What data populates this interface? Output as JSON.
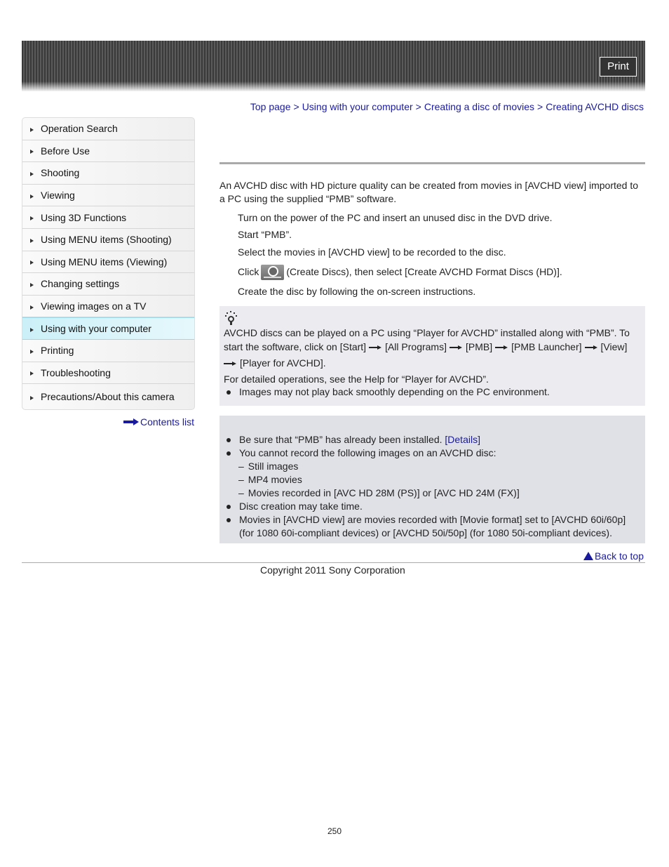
{
  "header": {
    "print_label": "Print"
  },
  "sidebar": {
    "items": [
      {
        "label": "Operation Search"
      },
      {
        "label": "Before Use"
      },
      {
        "label": "Shooting"
      },
      {
        "label": "Viewing"
      },
      {
        "label": "Using 3D Functions"
      },
      {
        "label": "Using MENU items (Shooting)"
      },
      {
        "label": "Using MENU items (Viewing)"
      },
      {
        "label": "Changing settings"
      },
      {
        "label": "Viewing images on a TV"
      },
      {
        "label": "Using with your computer",
        "active": true
      },
      {
        "label": "Printing"
      },
      {
        "label": "Troubleshooting"
      },
      {
        "label": "Precautions/About this camera"
      }
    ],
    "contents_link": "Contents list"
  },
  "breadcrumb": {
    "items": [
      "Top page",
      "Using with your computer",
      "Creating a disc of movies",
      "Creating AVCHD discs"
    ],
    "separator": ">"
  },
  "main": {
    "intro": "An AVCHD disc with HD picture quality can be created from movies in [AVCHD view] imported to a PC using the supplied “PMB” software.",
    "steps": [
      {
        "text": "Turn on the power of the PC and insert an unused disc in the DVD drive."
      },
      {
        "text": "Start “PMB”."
      },
      {
        "text": "Select the movies in [AVCHD view] to be recorded to the disc."
      },
      {
        "prefix": "Click",
        "icon": "create-discs-button-icon",
        "suffix": "(Create Discs), then select [Create AVCHD Format Discs (HD)]."
      },
      {
        "text": "Create the disc by following the on-screen instructions."
      }
    ],
    "hint": {
      "icon": "lightbulb-icon",
      "line1": "AVCHD discs can be played on a PC using “Player for AVCHD” installed along with “PMB”. To",
      "line2_parts": [
        "start the software, click on [Start]",
        "[All Programs]",
        "[PMB]",
        "[PMB Launcher]",
        "[View]"
      ],
      "line3": "[Player for AVCHD].",
      "line4": "For detailed operations, see the Help for “Player for AVCHD”.",
      "bullet": "Images may not play back smoothly depending on the PC environment."
    },
    "notes": {
      "bullets": [
        {
          "text": "Be sure that “PMB” has already been installed.",
          "link": "[Details]"
        },
        {
          "text": "You cannot record the following images on an AVCHD disc:",
          "subitems": [
            "Still images",
            "MP4 movies",
            "Movies recorded in [AVC HD 28M (PS)] or [AVC HD 24M (FX)]"
          ]
        },
        {
          "text": "Disc creation may take time."
        },
        {
          "text": "Movies in [AVCHD view] are movies recorded with [Movie format] set to [AVCHD 60i/60p]",
          "text2": "(for 1080 60i-compliant devices) or [AVCHD 50i/50p] (for 1080 50i-compliant devices)."
        }
      ],
      "dash": "–"
    }
  },
  "footer": {
    "back_to_top": "Back to top",
    "copyright": "Copyright 2011 Sony Corporation",
    "page_number": "250"
  }
}
